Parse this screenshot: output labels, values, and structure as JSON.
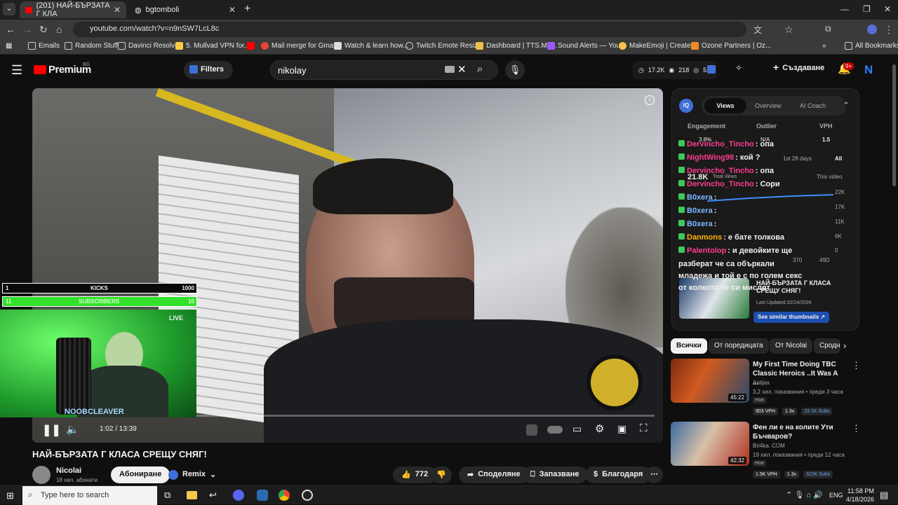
{
  "browser": {
    "tabs": [
      {
        "title": "(201) НАЙ-БЪРЗАТА Г КЛА"
      },
      {
        "title": "bgtomboli"
      }
    ],
    "url": "youtube.com/watch?v=n9nSW7LcL8c",
    "bookmarks": [
      "Emails",
      "Random Stuff",
      "Davinci Resolve",
      "5. Mullvad VPN for...",
      "Mail merge for Gma...",
      "Watch & learn how...",
      "Twitch Emote Resizer",
      "Dashboard | TTS.Mo...",
      "Sound Alerts — You...",
      "MakeEmoji | Create...",
      "Ozone Partners | Oz..."
    ],
    "all_bookmarks": "All Bookmarks"
  },
  "header": {
    "logo": "Premium",
    "region": "BG",
    "filters": "Filters",
    "search_value": "nikolay",
    "stats": {
      "views": "17.2K",
      "likes": "218",
      "watching": "5"
    },
    "create": "Създаване",
    "notif": "9+"
  },
  "player": {
    "time": "1:02 / 13:39",
    "kicks": {
      "left": "1",
      "label": "KICKS",
      "right": "1000"
    },
    "subs": {
      "left": "11",
      "label": "SUBSCRIBERS",
      "right": "10"
    },
    "live": "LIVE",
    "streamer": "NOOBCLEAVER",
    "progress": 0.076
  },
  "video": {
    "title": "НАЙ-БЪРЗАТА Г КЛАСА СРЕЩУ СНЯГ!",
    "channel": "Nicolai",
    "subs": "18 хил. абонати",
    "subscribe": "Абониране",
    "remix": "Remix",
    "likes": "772",
    "share": "Споделяне",
    "save": "Запазване",
    "thanks": "Благодаря"
  },
  "panel": {
    "tabs": [
      "Views",
      "Overview",
      "AI Coach"
    ],
    "cols": [
      "Engagement",
      "Outlier",
      "VPH"
    ],
    "vals": [
      "3.8%",
      "N/A",
      "1.5"
    ],
    "range": [
      "1st 28 days",
      "All"
    ],
    "total": "21.8K",
    "total_label": "Total views",
    "this_video": "This video",
    "yticks": [
      "22K",
      "17K",
      "11K",
      "6K",
      "0"
    ],
    "xticks": [
      "370",
      "49D"
    ],
    "card_title": "НАЙ-БЪРЗАТА Г КЛАСА СРЕЩУ СНЯГ!",
    "updated": "Last Updated 02/24/2026",
    "similar": "See similar thumbnails"
  },
  "chat": [
    {
      "user": "Dervincho_Tincho",
      "msg": ": опа",
      "color": "#ff3b8d"
    },
    {
      "user": "NightWing98",
      "msg": ": кой ?",
      "color": "#ff3b8d"
    },
    {
      "user": "Dervincho_Tincho",
      "msg": ": опа",
      "color": "#ff3b8d"
    },
    {
      "user": "Dervincho_Tincho",
      "msg": ": Сори",
      "color": "#ff3b8d"
    },
    {
      "user": "B0xera",
      "msg": ":",
      "color": "#7ab7ff"
    },
    {
      "user": "B0xera",
      "msg": ":",
      "color": "#7ab7ff"
    },
    {
      "user": "B0xera",
      "msg": ":",
      "color": "#7ab7ff"
    },
    {
      "user": "Danmons",
      "msg": ": е бате толкова",
      "color": "#ffb300"
    },
    {
      "user": "Palentolop",
      "msg": ": и девойките ще",
      "color": "#ff3b8d"
    }
  ],
  "chat_cont": [
    "разберат че са объркали",
    "младежа и той е с по голем секс",
    "от колкото те си мислят"
  ],
  "chips": [
    "Всички",
    "От поредицата",
    "От Nicolai",
    "Сродн"
  ],
  "related": [
    {
      "title": "My First Time Doing TBC Classic Heroics ..It Was A ...",
      "channel": "Antijax",
      "views": "3,2 хил. показвания • преди 3 часа",
      "badge": "Нов",
      "dur": "45:22",
      "vph": "903 VPH",
      "mult": "1.3x",
      "subs": "23.1K Subs"
    },
    {
      "title": "Фен ли е на колите Ути Бъчваров?",
      "channel": "Bri4ka. COM",
      "views": "19 хил. показвания • преди 12 часа",
      "badge": "Нов",
      "dur": "42:32",
      "vph": "1.5K VPH",
      "mult": "1.3x",
      "subs": "322K Subs"
    }
  ],
  "taskbar": {
    "search": "Type here to search",
    "lang": "ENG",
    "time": "11:58 PM",
    "date": "4/18/2026"
  }
}
